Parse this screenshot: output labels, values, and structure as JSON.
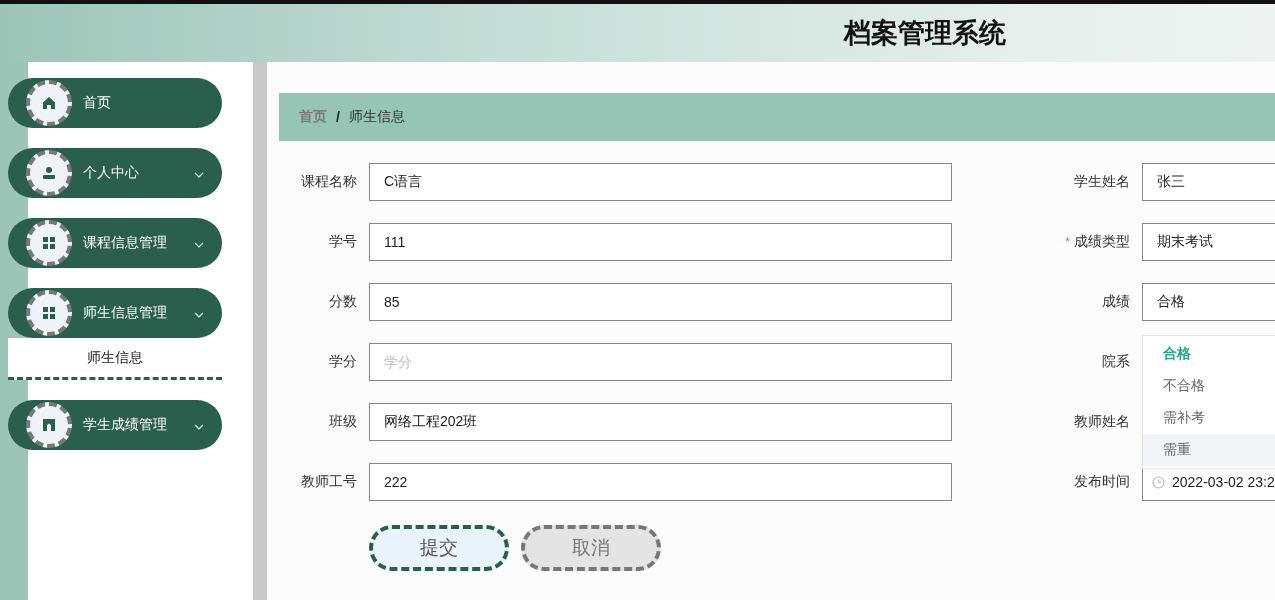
{
  "header": {
    "title": "档案管理系统"
  },
  "sidebar": {
    "items": [
      {
        "label": "首页",
        "kind": "link"
      },
      {
        "label": "个人中心",
        "kind": "submenu"
      },
      {
        "label": "课程信息管理",
        "kind": "submenu"
      },
      {
        "label": "师生信息管理",
        "kind": "submenu",
        "children": [
          {
            "label": "师生信息",
            "selected": true
          }
        ]
      },
      {
        "label": "学生成绩管理",
        "kind": "submenu"
      }
    ]
  },
  "breadcrumb": {
    "items": [
      "首页",
      "师生信息"
    ],
    "separator": "/"
  },
  "form": {
    "required_mark": "*",
    "left_fields": [
      {
        "label": "课程名称",
        "value": "C语言"
      },
      {
        "label": "学号",
        "value": "111"
      },
      {
        "label": "分数",
        "value": "85"
      },
      {
        "label": "学分",
        "placeholder": "学分"
      },
      {
        "label": "班级",
        "value": "网络工程202班"
      },
      {
        "label": "教师工号",
        "value": "222"
      }
    ],
    "right_fields": [
      {
        "label": "学生姓名",
        "kind": "text",
        "required": false,
        "value": "张三"
      },
      {
        "label": "成绩类型",
        "kind": "text",
        "required": true,
        "value": "期末考试"
      },
      {
        "label": "成绩",
        "kind": "select",
        "required": false,
        "value": "合格",
        "open": true,
        "options": [
          {
            "label": "合格",
            "selected": true,
            "hovered": false
          },
          {
            "label": "不合格",
            "selected": false,
            "hovered": false
          },
          {
            "label": "需补考",
            "selected": false,
            "hovered": false
          },
          {
            "label": "需重",
            "selected": false,
            "hovered": true
          }
        ]
      },
      {
        "label": "院系",
        "kind": "text",
        "required": false
      },
      {
        "label": "教师姓名",
        "kind": "text",
        "required": false
      },
      {
        "label": "发布时间",
        "kind": "date",
        "required": false,
        "value": "2022-03-02 23:2"
      }
    ],
    "buttons": [
      {
        "label": "提交",
        "kind": "primary"
      },
      {
        "label": "取消",
        "kind": "secondary"
      }
    ]
  }
}
